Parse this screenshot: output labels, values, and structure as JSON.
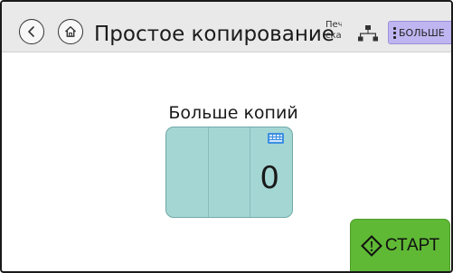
{
  "header": {
    "title": "Простое копирование",
    "status_text": "Печ\nска",
    "more_label": "БОЛЬШЕ",
    "icons": {
      "back": "back-arrow-icon",
      "home": "home-icon",
      "network": "network-icon",
      "more": "kebab-menu-icon"
    }
  },
  "main": {
    "copies_label": "Больше копий",
    "copies_value": "0",
    "keypad_icon": "keypad-icon"
  },
  "start": {
    "label": "СТАРТ",
    "icon": "start-diamond-icon"
  },
  "colors": {
    "header_bg": "#e9e9e9",
    "card_bg": "#a4d6d4",
    "start_bg": "#5fb935",
    "more_bg": "#bfb5f0",
    "keypad_blue": "#3d8fe0"
  }
}
